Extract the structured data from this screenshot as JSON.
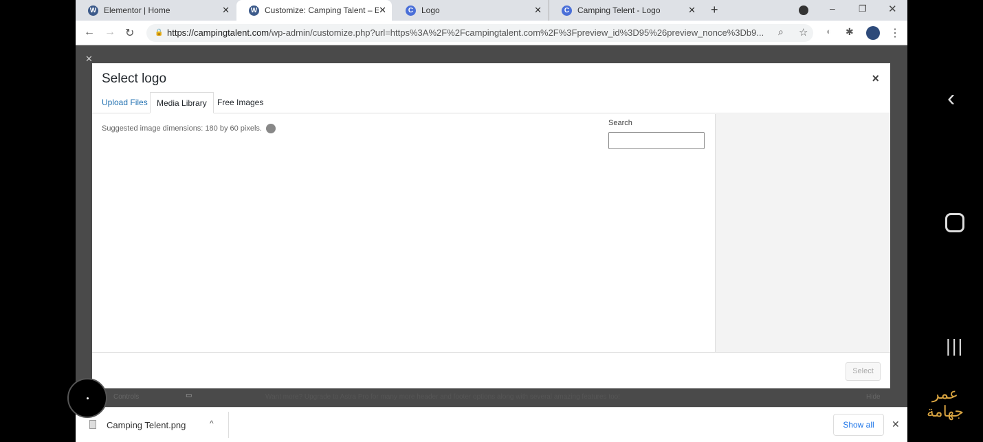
{
  "browser": {
    "tabs": [
      {
        "label": "Elementor | Home",
        "icon": "wordpress-icon"
      },
      {
        "label": "Customize: Camping Talent – Eve",
        "icon": "wordpress-icon",
        "active": true
      },
      {
        "label": "Logo",
        "icon": "c-logo-icon"
      },
      {
        "label": "Camping Telent - Logo",
        "icon": "c-logo-icon"
      }
    ],
    "url_host": "https://campingtalent.com",
    "url_path": "/wp-admin/customize.php?url=https%3A%2F%2Fcampingtalent.com%2F%3Fpreview_id%3D95%26preview_nonce%3Db9..."
  },
  "modal": {
    "title": "Select logo",
    "close": "×",
    "tabs": [
      "Upload Files",
      "Media Library",
      "Free Images"
    ],
    "active_tab": "Media Library",
    "hint": "Suggested image dimensions: 180 by 60 pixels.",
    "search_label": "Search",
    "search_value": "",
    "select_button": "Select"
  },
  "background": {
    "controls_label": "Controls",
    "upgrade_text": "Want more? Upgrade to Astra Pro for many more header and footer options along with several amazing features too!",
    "hide_label": "Hide"
  },
  "downloads": {
    "file": "Camping Telent.png",
    "show_all": "Show all"
  },
  "watermark": {
    "line1": "عمر",
    "line2": "جهامة"
  },
  "colors": {
    "link": "#2271b1",
    "wp_blue": "#21759b"
  }
}
